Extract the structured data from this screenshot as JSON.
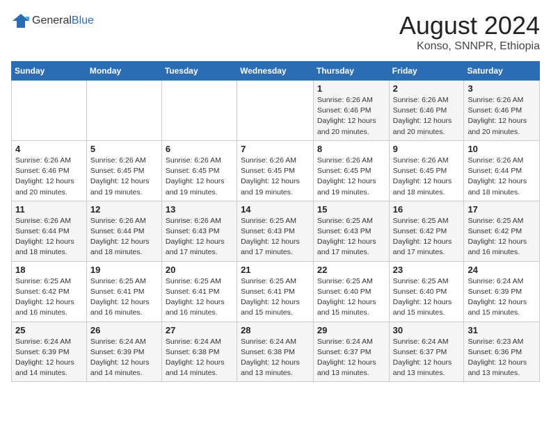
{
  "header": {
    "logo_general": "General",
    "logo_blue": "Blue",
    "month_title": "August 2024",
    "location": "Konso, SNNPR, Ethiopia"
  },
  "days_of_week": [
    "Sunday",
    "Monday",
    "Tuesday",
    "Wednesday",
    "Thursday",
    "Friday",
    "Saturday"
  ],
  "weeks": [
    [
      {
        "day": "",
        "info": ""
      },
      {
        "day": "",
        "info": ""
      },
      {
        "day": "",
        "info": ""
      },
      {
        "day": "",
        "info": ""
      },
      {
        "day": "1",
        "info": "Sunrise: 6:26 AM\nSunset: 6:46 PM\nDaylight: 12 hours\nand 20 minutes."
      },
      {
        "day": "2",
        "info": "Sunrise: 6:26 AM\nSunset: 6:46 PM\nDaylight: 12 hours\nand 20 minutes."
      },
      {
        "day": "3",
        "info": "Sunrise: 6:26 AM\nSunset: 6:46 PM\nDaylight: 12 hours\nand 20 minutes."
      }
    ],
    [
      {
        "day": "4",
        "info": "Sunrise: 6:26 AM\nSunset: 6:46 PM\nDaylight: 12 hours\nand 20 minutes."
      },
      {
        "day": "5",
        "info": "Sunrise: 6:26 AM\nSunset: 6:45 PM\nDaylight: 12 hours\nand 19 minutes."
      },
      {
        "day": "6",
        "info": "Sunrise: 6:26 AM\nSunset: 6:45 PM\nDaylight: 12 hours\nand 19 minutes."
      },
      {
        "day": "7",
        "info": "Sunrise: 6:26 AM\nSunset: 6:45 PM\nDaylight: 12 hours\nand 19 minutes."
      },
      {
        "day": "8",
        "info": "Sunrise: 6:26 AM\nSunset: 6:45 PM\nDaylight: 12 hours\nand 19 minutes."
      },
      {
        "day": "9",
        "info": "Sunrise: 6:26 AM\nSunset: 6:45 PM\nDaylight: 12 hours\nand 18 minutes."
      },
      {
        "day": "10",
        "info": "Sunrise: 6:26 AM\nSunset: 6:44 PM\nDaylight: 12 hours\nand 18 minutes."
      }
    ],
    [
      {
        "day": "11",
        "info": "Sunrise: 6:26 AM\nSunset: 6:44 PM\nDaylight: 12 hours\nand 18 minutes."
      },
      {
        "day": "12",
        "info": "Sunrise: 6:26 AM\nSunset: 6:44 PM\nDaylight: 12 hours\nand 18 minutes."
      },
      {
        "day": "13",
        "info": "Sunrise: 6:26 AM\nSunset: 6:43 PM\nDaylight: 12 hours\nand 17 minutes."
      },
      {
        "day": "14",
        "info": "Sunrise: 6:25 AM\nSunset: 6:43 PM\nDaylight: 12 hours\nand 17 minutes."
      },
      {
        "day": "15",
        "info": "Sunrise: 6:25 AM\nSunset: 6:43 PM\nDaylight: 12 hours\nand 17 minutes."
      },
      {
        "day": "16",
        "info": "Sunrise: 6:25 AM\nSunset: 6:42 PM\nDaylight: 12 hours\nand 17 minutes."
      },
      {
        "day": "17",
        "info": "Sunrise: 6:25 AM\nSunset: 6:42 PM\nDaylight: 12 hours\nand 16 minutes."
      }
    ],
    [
      {
        "day": "18",
        "info": "Sunrise: 6:25 AM\nSunset: 6:42 PM\nDaylight: 12 hours\nand 16 minutes."
      },
      {
        "day": "19",
        "info": "Sunrise: 6:25 AM\nSunset: 6:41 PM\nDaylight: 12 hours\nand 16 minutes."
      },
      {
        "day": "20",
        "info": "Sunrise: 6:25 AM\nSunset: 6:41 PM\nDaylight: 12 hours\nand 16 minutes."
      },
      {
        "day": "21",
        "info": "Sunrise: 6:25 AM\nSunset: 6:41 PM\nDaylight: 12 hours\nand 15 minutes."
      },
      {
        "day": "22",
        "info": "Sunrise: 6:25 AM\nSunset: 6:40 PM\nDaylight: 12 hours\nand 15 minutes."
      },
      {
        "day": "23",
        "info": "Sunrise: 6:25 AM\nSunset: 6:40 PM\nDaylight: 12 hours\nand 15 minutes."
      },
      {
        "day": "24",
        "info": "Sunrise: 6:24 AM\nSunset: 6:39 PM\nDaylight: 12 hours\nand 15 minutes."
      }
    ],
    [
      {
        "day": "25",
        "info": "Sunrise: 6:24 AM\nSunset: 6:39 PM\nDaylight: 12 hours\nand 14 minutes."
      },
      {
        "day": "26",
        "info": "Sunrise: 6:24 AM\nSunset: 6:39 PM\nDaylight: 12 hours\nand 14 minutes."
      },
      {
        "day": "27",
        "info": "Sunrise: 6:24 AM\nSunset: 6:38 PM\nDaylight: 12 hours\nand 14 minutes."
      },
      {
        "day": "28",
        "info": "Sunrise: 6:24 AM\nSunset: 6:38 PM\nDaylight: 12 hours\nand 13 minutes."
      },
      {
        "day": "29",
        "info": "Sunrise: 6:24 AM\nSunset: 6:37 PM\nDaylight: 12 hours\nand 13 minutes."
      },
      {
        "day": "30",
        "info": "Sunrise: 6:24 AM\nSunset: 6:37 PM\nDaylight: 12 hours\nand 13 minutes."
      },
      {
        "day": "31",
        "info": "Sunrise: 6:23 AM\nSunset: 6:36 PM\nDaylight: 12 hours\nand 13 minutes."
      }
    ]
  ]
}
